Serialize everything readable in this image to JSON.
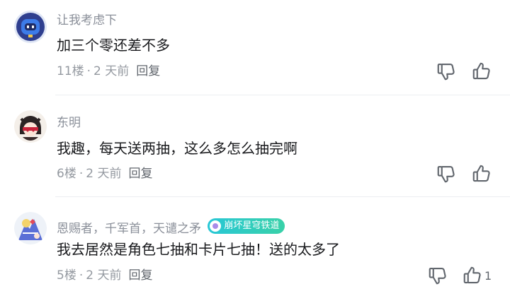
{
  "comments": [
    {
      "username": "让我考虑下",
      "content": "加三个零还差不多",
      "floor": "11楼",
      "time": "2 天前",
      "reply_label": "回复",
      "likes": ""
    },
    {
      "username": "东明",
      "content": "我趣，每天送两抽，这么多怎么抽完啊",
      "floor": "6楼",
      "time": "2 天前",
      "reply_label": "回复",
      "likes": ""
    },
    {
      "username": "恩赐者，千军首，天谴之矛",
      "badge": "崩坏星穹铁道",
      "content": "我去居然是角色七抽和卡片七抽！送的太多了",
      "floor": "5楼",
      "time": "2 天前",
      "reply_label": "回复",
      "likes": "1"
    }
  ],
  "separator": "·",
  "icons": {
    "dislike": "thumbs-down-icon",
    "like": "thumbs-up-icon"
  },
  "colors": {
    "username": "#8a8f99",
    "content": "#18191c",
    "meta": "#9499a0",
    "badge_start": "#28c7d6",
    "badge_end": "#39d1a8"
  }
}
